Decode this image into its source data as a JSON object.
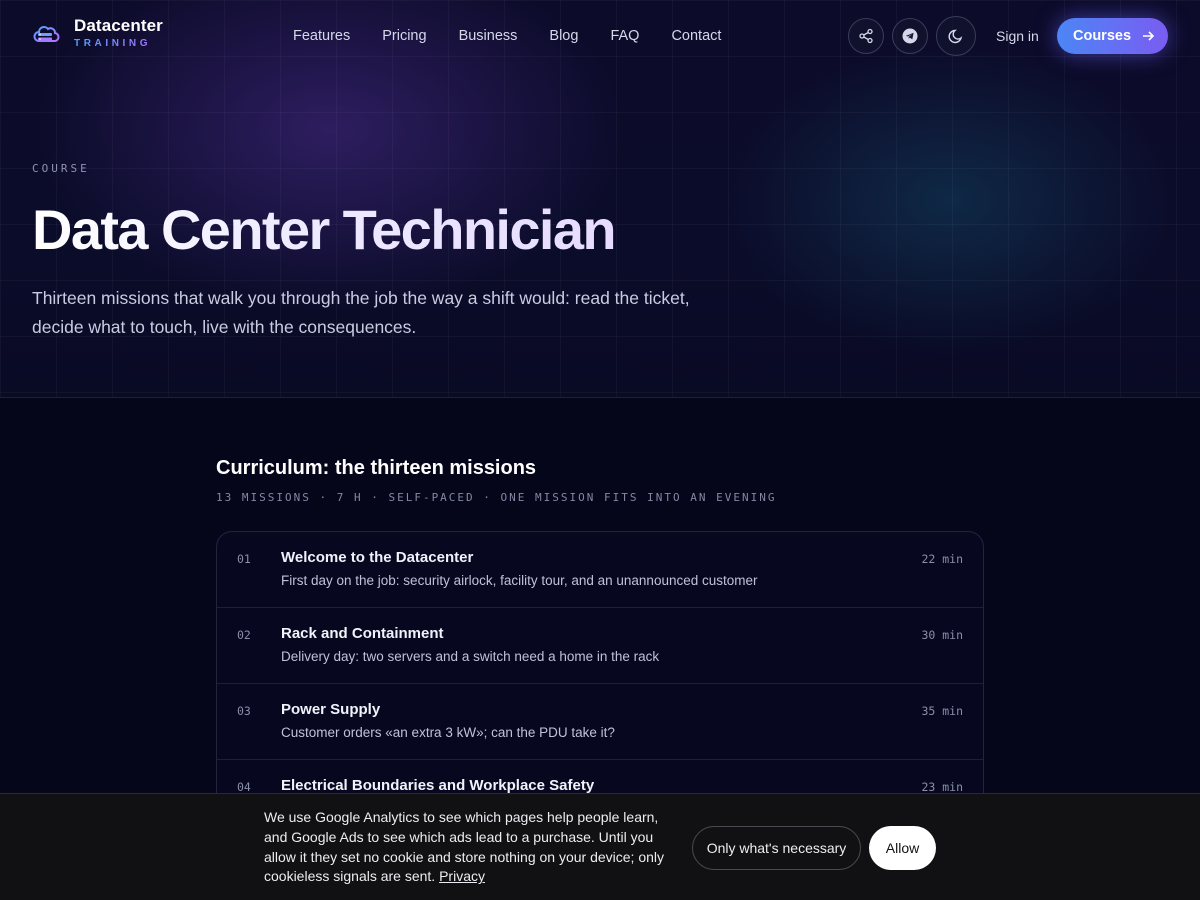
{
  "brand": {
    "name": "Datacenter",
    "tagline": "TRAINING"
  },
  "nav": {
    "items": [
      "Features",
      "Pricing",
      "Business",
      "Blog",
      "FAQ",
      "Contact"
    ],
    "sign_in": "Sign in",
    "cta": "Courses",
    "icons": [
      "share-icon",
      "telegram-icon",
      "moon-icon"
    ]
  },
  "hero": {
    "eyebrow": "COURSE",
    "title": "Data Center Technician",
    "lead": "Thirteen missions that walk you through the job the way a shift would: read the ticket, decide what to touch, live with the consequences."
  },
  "curriculum": {
    "title": "Curriculum: the thirteen missions",
    "meta": "13 MISSIONS · 7 H · SELF-PACED · ONE MISSION FITS INTO AN EVENING",
    "missions": [
      {
        "num": "01",
        "title": "Welcome to the Datacenter",
        "desc": "First day on the job: security airlock, facility tour, and an unannounced customer",
        "duration": "22 min"
      },
      {
        "num": "02",
        "title": "Rack and Containment",
        "desc": "Delivery day: two servers and a switch need a home in the rack",
        "duration": "30 min"
      },
      {
        "num": "03",
        "title": "Power Supply",
        "desc": "Customer orders «an extra 3 kW»; can the PDU take it?",
        "duration": "35 min"
      },
      {
        "num": "04",
        "title": "Electrical Boundaries and Workplace Safety",
        "desc": "",
        "duration": "23 min"
      }
    ]
  },
  "cookie": {
    "text": "We use Google Analytics to see which pages help people learn, and Google Ads to see which ads lead to a purchase. Until you allow it they set no cookie and store nothing on your device; only cookieless signals are sent.",
    "privacy_link": "Privacy",
    "necessary_label": "Only what's necessary",
    "allow_label": "Allow"
  },
  "colors": {
    "accent_start": "#4c86f5",
    "accent_end": "#7a5cf2",
    "background": "#05061a"
  }
}
